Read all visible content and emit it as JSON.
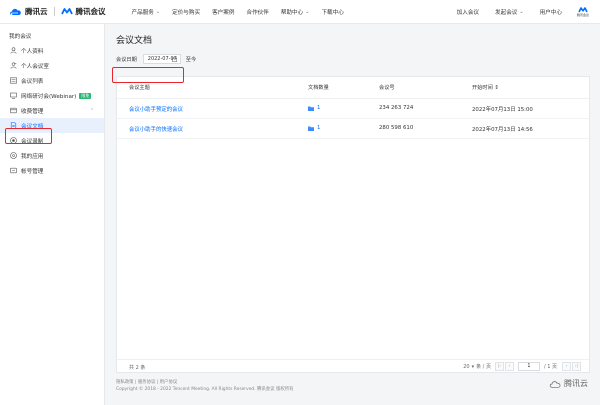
{
  "header": {
    "brand1": "腾讯云",
    "brand2": "腾讯会议",
    "nav": [
      "产品服务",
      "定价与购买",
      "客户案例",
      "合作伙伴",
      "帮助中心",
      "下载中心"
    ],
    "nav_chev": [
      true,
      false,
      false,
      false,
      true,
      false
    ],
    "right": [
      "加入会议",
      "发起会议",
      "用户中心"
    ],
    "right_chev": [
      false,
      true,
      false
    ],
    "mini_logo_text": "腾讯会议"
  },
  "sidebar": {
    "heading": "我的会议",
    "items": [
      {
        "label": "个人资料",
        "icon": "user-icon"
      },
      {
        "label": "个人会议室",
        "icon": "room-icon"
      },
      {
        "label": "会议列表",
        "icon": "list-icon"
      },
      {
        "label": "网络研讨会(Webinar)",
        "icon": "webinar-icon",
        "badge": "限免"
      },
      {
        "label": "收费管理",
        "icon": "fee-icon",
        "caret": "⌃"
      },
      {
        "label": "会议文档",
        "icon": "document-icon",
        "active": true
      },
      {
        "label": "会议录制",
        "icon": "record-icon"
      },
      {
        "label": "我的应用",
        "icon": "app-icon"
      },
      {
        "label": "帐号管理",
        "icon": "account-icon"
      }
    ]
  },
  "main": {
    "title": "会议文档",
    "filter_label": "会议日期",
    "date_value": "2022-07-07",
    "date_to": "至今",
    "columns": [
      "会议主题",
      "文档数量",
      "会议号",
      "开始时间 ⇕"
    ],
    "rows": [
      {
        "topic": "会议小助手预定的会议",
        "docs": "1",
        "meeting_id": "234 263 724",
        "start": "2022年07月13日 15:00"
      },
      {
        "topic": "会议小助手的快速会议",
        "docs": "1",
        "meeting_id": "280 598 610",
        "start": "2022年07月13日 14:56"
      }
    ],
    "total": "共 2 条",
    "page_size": "20",
    "page_size_suffix": "条 / 页",
    "page_current": "1",
    "page_total": "/ 1 页"
  },
  "footer": {
    "links": "隐私政策 | 服务协议 | 用户协议",
    "copyright": "Copyright © 2018 - 2022 Tencent Meeting. All Rights Reserved. 腾讯会议 版权所有",
    "brand": "腾讯云"
  },
  "colors": {
    "accent": "#006eff",
    "highlight": "#e8262d",
    "badge": "#2bb673"
  }
}
